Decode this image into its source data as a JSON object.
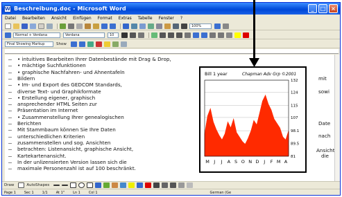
{
  "window": {
    "title": "Beschreibung.doc - Microsoft Word"
  },
  "menu": [
    "Datei",
    "Bearbeiten",
    "Ansicht",
    "Einfügen",
    "Format",
    "Extras",
    "Tabelle",
    "Fenster",
    "?"
  ],
  "toolbars": {
    "style_box": "Normal + Verdana",
    "font_box": "Verdana",
    "size_box": "10",
    "zoom_box": "100%",
    "markup_box": "Final Showing Markup",
    "show_label": "Show"
  },
  "document": {
    "lines": [
      "• intuitives Bearbeiten Ihrer Datenbestände mit Drag & Drop,",
      "• mächtige Suchfunktionen",
      "• graphische Nachfahren- und Ahnentafeln",
      "Bildern",
      "• Im- und Export des GEDCOM Standards,",
      "diverse Text- und Graphikformate",
      "• Erstellung eigener, graphisch",
      "ansprechender HTML Seiten zur",
      "Präsentation im Internet",
      "• Zusammenstellung Ihrer genealogischen",
      "Berichten",
      "Mit Stammbaum können Sie Ihre Daten",
      "unterschiedlichen Kriterien",
      "zusammenstellen und sog. Ansichten",
      "betrachten: Listenansicht, graphische Ansicht,",
      "Kartekartenansicht.",
      "In der unlizensierten Version lassen sich die",
      "maximale Personenzahl ist auf 100 beschränkt."
    ],
    "right_fragments": [
      "mit",
      "sowi",
      "Date",
      "nach",
      "Ansicht",
      "die"
    ]
  },
  "chart_data": {
    "type": "area",
    "title": "Bill 1 year",
    "subtitle": "Chapman Adv Grp ©2001",
    "categories": [
      "M",
      "J",
      "J",
      "A",
      "S",
      "O",
      "N",
      "D",
      "J",
      "F",
      "M",
      "A"
    ],
    "ylim": [
      81,
      132
    ],
    "yticks": [
      132,
      124,
      115,
      107,
      98.1,
      89.5,
      81
    ],
    "series": [
      {
        "values": [
          96,
          108,
          113,
          104,
          99,
          95,
          92,
          96,
          104,
          100,
          106,
          97,
          94,
          91,
          89,
          93,
          98,
          105,
          102,
          110,
          118,
          122,
          116,
          112,
          106,
          103,
          100,
          94,
          92,
          98
        ]
      }
    ],
    "colors": {
      "fill": "#ff2a00",
      "background": "#ffffff"
    }
  },
  "drawbar": {
    "draw_label": "Draw",
    "autoshapes_label": "AutoShapes"
  },
  "status": [
    "Page 1",
    "Sec 1",
    "1/1",
    "At 1\"",
    "Ln 1",
    "Col 1",
    "German (Ge"
  ]
}
